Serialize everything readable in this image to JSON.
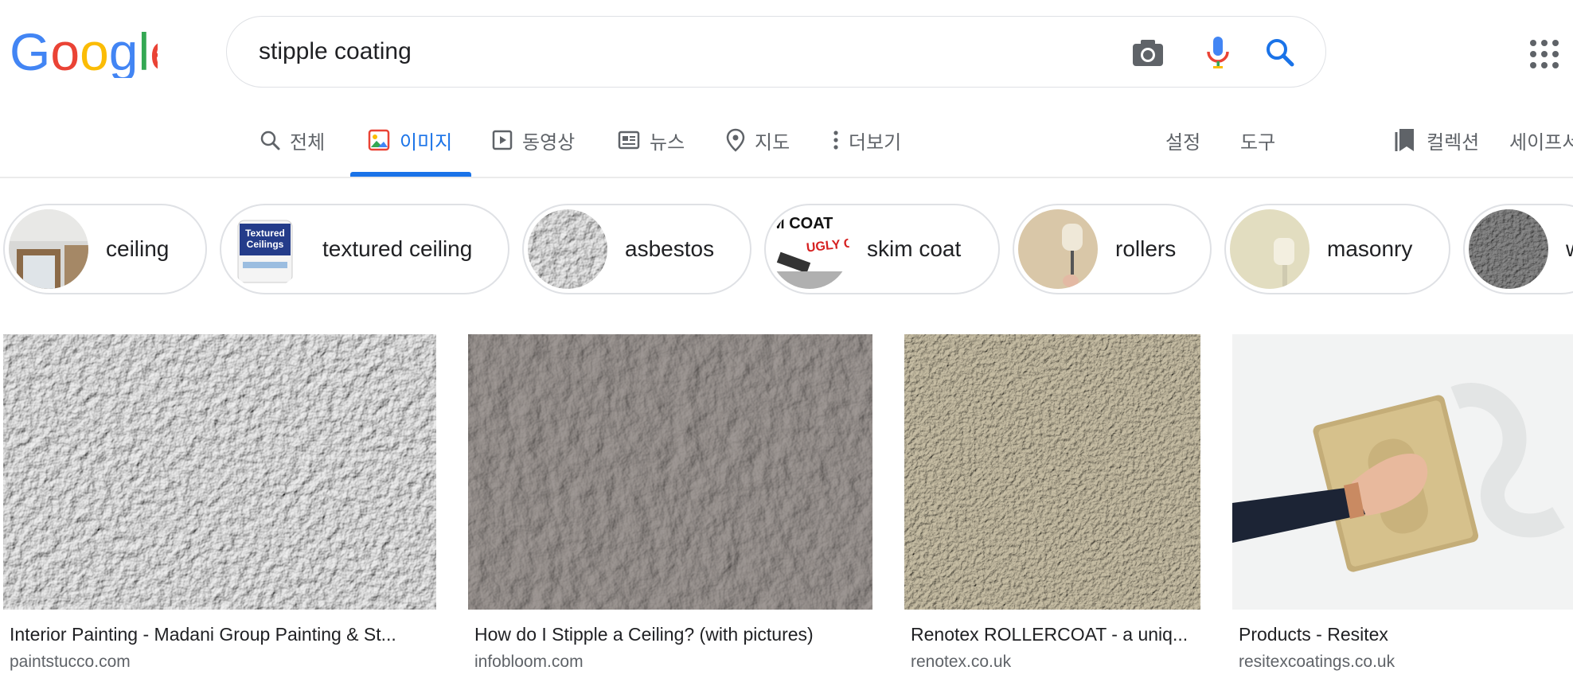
{
  "logo": {
    "text": "Google"
  },
  "search": {
    "query": "stipple coating",
    "icons": [
      "camera-icon",
      "microphone-icon",
      "search-icon"
    ]
  },
  "apps_icon": "apps-grid-icon",
  "tabs": [
    {
      "label": "전체",
      "icon": "search-icon",
      "active": false
    },
    {
      "label": "이미지",
      "icon": "image-icon",
      "active": true
    },
    {
      "label": "동영상",
      "icon": "video-icon",
      "active": false
    },
    {
      "label": "뉴스",
      "icon": "news-icon",
      "active": false
    },
    {
      "label": "지도",
      "icon": "map-pin-icon",
      "active": false
    },
    {
      "label": "더보기",
      "icon": "more-vert-icon",
      "active": false
    }
  ],
  "tools": {
    "settings": "설정",
    "tools": "도구"
  },
  "collections": {
    "label": "컬렉션",
    "safesearch": "세이프서"
  },
  "chips": [
    {
      "label": "ceiling"
    },
    {
      "label": "textured ceiling"
    },
    {
      "label": "asbestos"
    },
    {
      "label": "skim coat"
    },
    {
      "label": "rollers"
    },
    {
      "label": "masonry"
    },
    {
      "label": "w"
    }
  ],
  "chip_thumb_text": {
    "textured_ceilings": "Textured Ceilings",
    "skim_coat": "M COAT",
    "ugly": "UGLY CE"
  },
  "results": [
    {
      "title": "Interior Painting - Madani Group Painting & St...",
      "site": "paintstucco.com"
    },
    {
      "title": "How do I Stipple a Ceiling? (with pictures)",
      "site": "infobloom.com"
    },
    {
      "title": "Renotex ROLLERCOAT - a uniq...",
      "site": "renotex.co.uk"
    },
    {
      "title": "Products - Resitex",
      "site": "resitexcoatings.co.uk"
    }
  ],
  "colors": {
    "accent": "#1a73e8",
    "text": "#202124",
    "muted": "#5f6368",
    "border": "#dfe1e5"
  }
}
